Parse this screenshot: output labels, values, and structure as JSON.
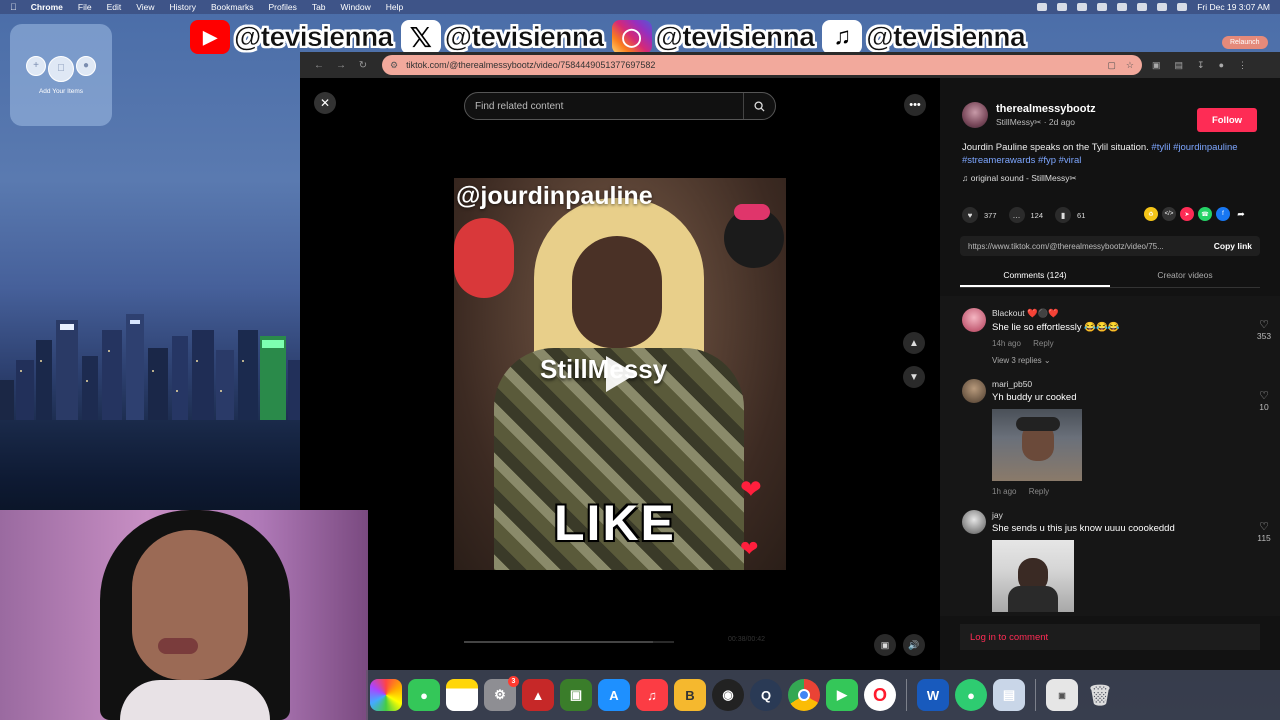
{
  "menubar": {
    "app_name": "Chrome",
    "items": [
      "File",
      "Edit",
      "View",
      "History",
      "Bookmarks",
      "Profiles",
      "Tab",
      "Window",
      "Help"
    ],
    "datetime": "Fri Dec 19  3:07 AM"
  },
  "banner": {
    "handle": "@tevisienna",
    "platforms": [
      "youtube-icon",
      "x-icon",
      "instagram-icon",
      "tiktok-icon"
    ]
  },
  "widget": {
    "label": "Add Your Items"
  },
  "browser": {
    "url": "tiktok.com/@therealmessybootz/video/7584449051377697582",
    "relaunch_label": "Relaunch"
  },
  "video": {
    "search_placeholder": "Find related content",
    "overlay_handle": "@jourdinpauline",
    "overlay_brand": "StillMessy",
    "overlay_text": "LIKE",
    "timestamp": "00:38/00:42",
    "progress_fraction": 0.9
  },
  "post": {
    "author": "therealmessybootz",
    "author_sub": "StillMessy✂ · 2d ago",
    "follow_label": "Follow",
    "description_text": "Jourdin Pauline speaks on the Tylil situation.",
    "hashtags": [
      "#tylil",
      "#jourdinpauline",
      "#streamerawards",
      "#fyp",
      "#viral"
    ],
    "sound": "original sound - StillMessy✂",
    "likes": "377",
    "comments": "124",
    "saves": "61",
    "link": "https://www.tiktok.com/@therealmessybootz/video/75...",
    "copy_link_label": "Copy link"
  },
  "tabs": [
    {
      "label": "Comments (124)",
      "active": true
    },
    {
      "label": "Creator videos",
      "active": false
    }
  ],
  "comments": [
    {
      "user": "Blackout ❤️⚫❤️",
      "text": "She lie so effortlessly 😂😂😂",
      "time": "14h ago",
      "reply": "Reply",
      "replies": "View 3 replies",
      "likes": "353"
    },
    {
      "user": "mari_pb50",
      "text": "Yh buddy ur cooked",
      "time": "1h ago",
      "reply": "Reply",
      "likes": "10"
    },
    {
      "user": "jay",
      "text": "She sends u this jus know uuuu coookeddd",
      "likes": "115"
    }
  ],
  "login_prompt": "Log in to comment",
  "dock": {
    "apps": [
      "photos",
      "messages",
      "notes",
      "system-settings",
      "app-x",
      "minecraft",
      "app-store",
      "music",
      "app-b",
      "obs",
      "quicktime",
      "chrome",
      "facetime",
      "opera",
      "word",
      "app-green",
      "preview",
      "mov-file",
      "trash"
    ],
    "settings_badge": "3"
  }
}
